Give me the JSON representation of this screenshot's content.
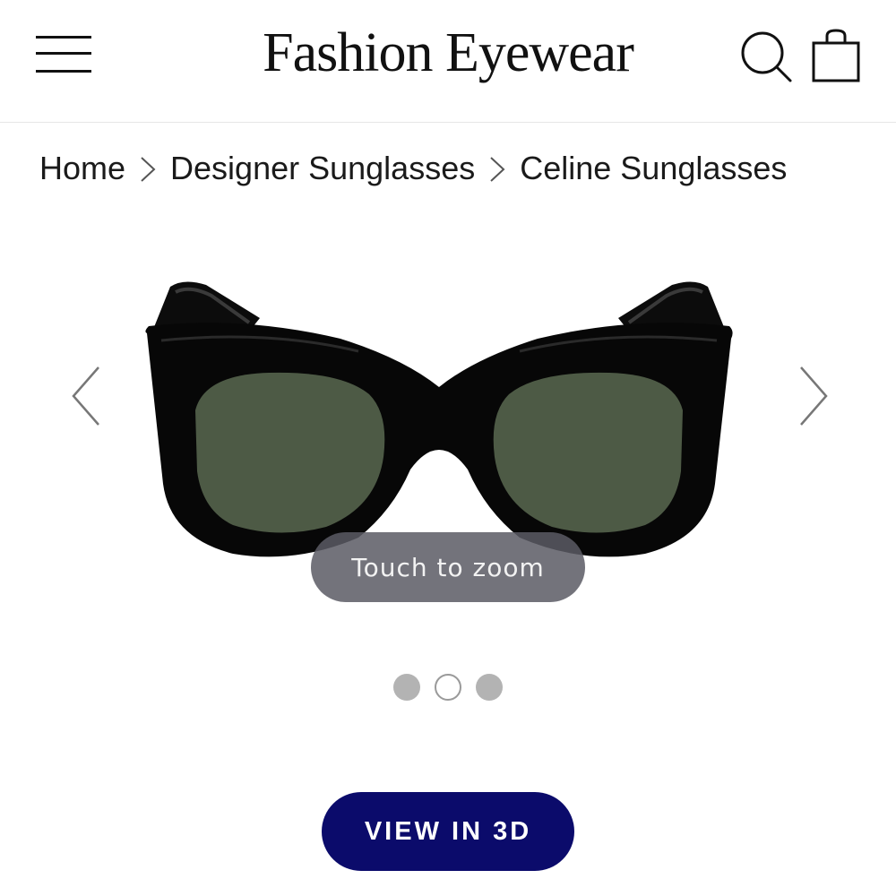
{
  "header": {
    "brand": "Fashion Eyewear",
    "icons": [
      "menu-icon",
      "search-icon",
      "shopping-bag-icon"
    ]
  },
  "breadcrumb": [
    {
      "label": "Home"
    },
    {
      "label": "Designer Sunglasses"
    },
    {
      "label": "Celine Sunglasses"
    }
  ],
  "gallery": {
    "image_alt": "Black cat-eye sunglasses with green lenses",
    "zoom_hint": "Touch to zoom",
    "image_count": 3,
    "active_index": 1
  },
  "cta": {
    "label": "VIEW IN 3D",
    "color": "#0b0b6b"
  }
}
